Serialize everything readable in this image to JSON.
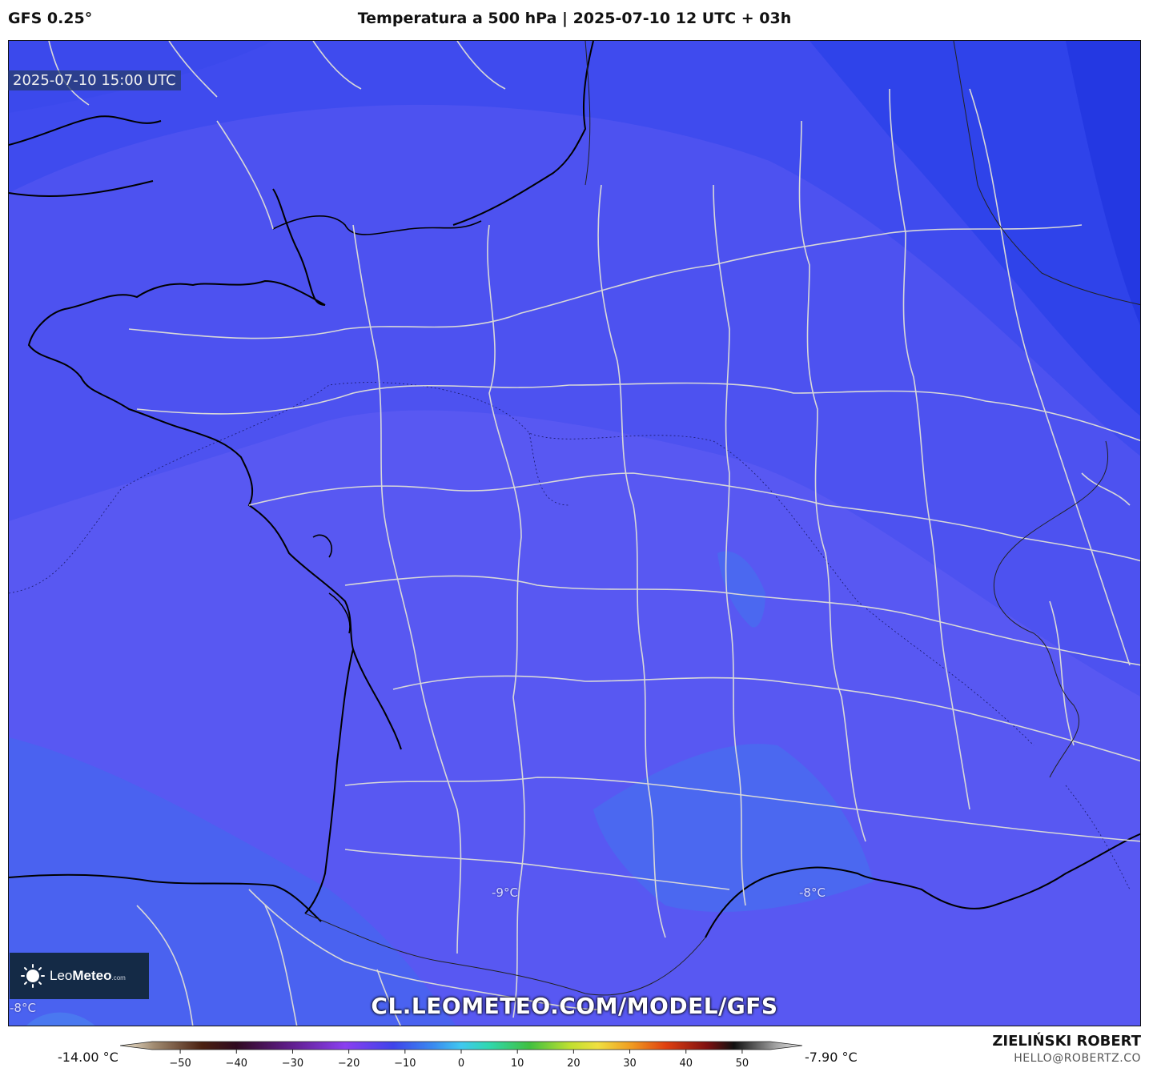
{
  "header": {
    "model_label": "GFS 0.25°",
    "title": "Temperatura a 500 hPa | 2025-07-10 12 UTC + 03h"
  },
  "map": {
    "valid_time": "2025-07-10 15:00 UTC",
    "url": "CL.LEOMETEO.COM/MODEL/GFS",
    "contour_labels": [
      "-9°C",
      "-8°C",
      "-8°C"
    ],
    "colors": {
      "field_dark": "#2a3ee6",
      "field_mid": "#4d52f0",
      "field_light": "#5a58f2",
      "field_warm": "#4a6cf0",
      "coastline": "#000000",
      "borders": "#d8d8d8"
    }
  },
  "logo": {
    "brand_prefix": "Leo",
    "brand_bold": "Meteo",
    "brand_domain": ".com"
  },
  "colorbar": {
    "min_label": "-14.00 °C",
    "max_label": "-7.90 °C",
    "ticks": [
      "−50",
      "−40",
      "−30",
      "−20",
      "−10",
      "0",
      "10",
      "20",
      "30",
      "40",
      "50"
    ],
    "tick_values": [
      -50,
      -40,
      -30,
      -20,
      -10,
      0,
      10,
      20,
      30,
      40,
      50
    ],
    "range": [
      -55,
      55
    ]
  },
  "footer": {
    "author": "ZIELIŃSKI ROBERT",
    "email": "HELLO@ROBERTZ.CO"
  }
}
